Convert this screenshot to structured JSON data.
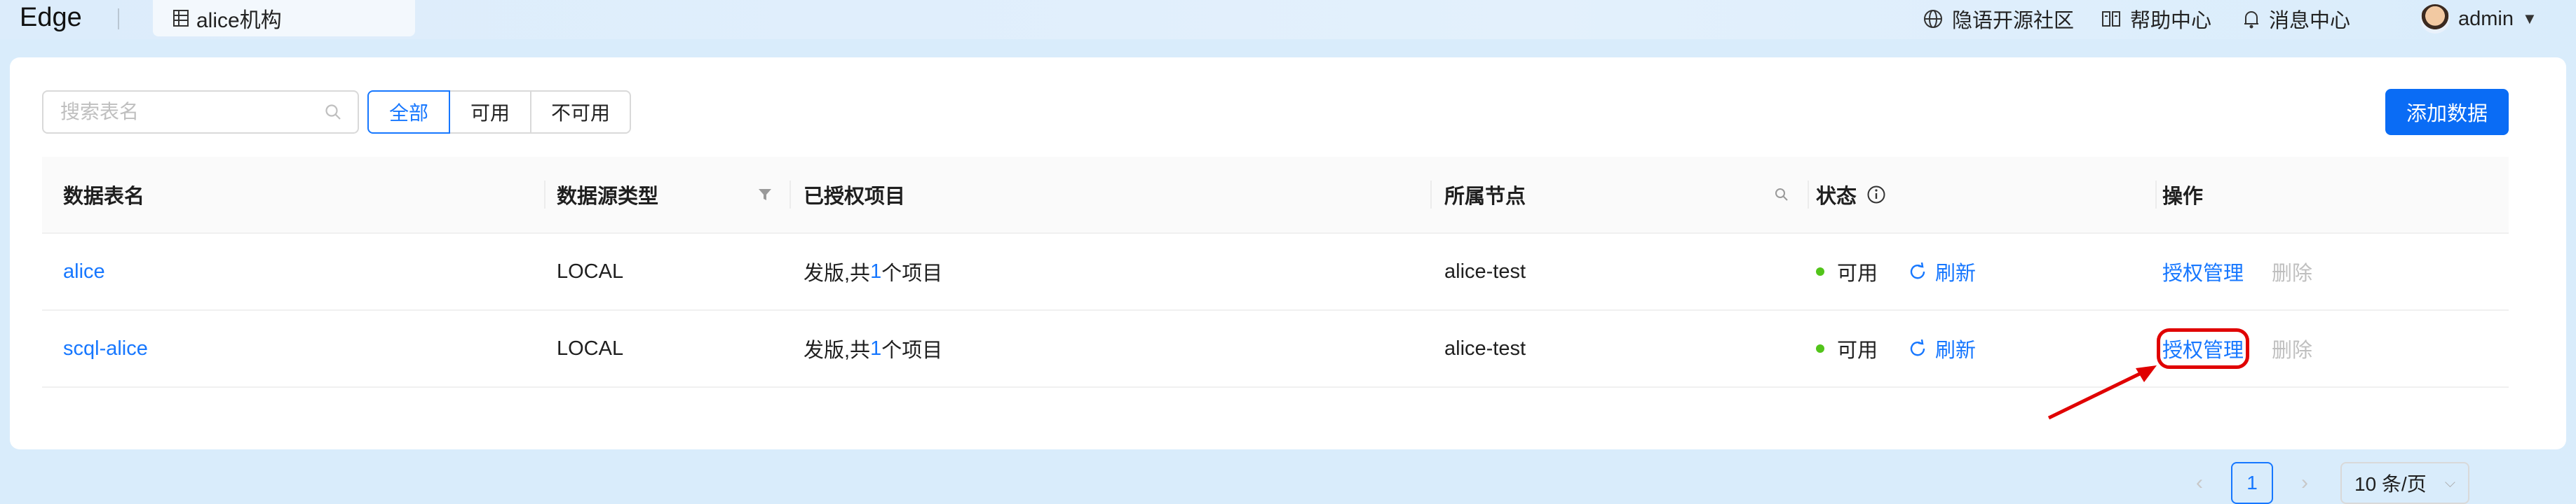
{
  "header": {
    "brand": "Edge",
    "org_tab": "alice机构",
    "nav": [
      {
        "label": "隐语开源社区",
        "icon": "globe-icon"
      },
      {
        "label": "帮助中心",
        "icon": "book-icon"
      },
      {
        "label": "消息中心",
        "icon": "bell-icon"
      }
    ],
    "user": "admin"
  },
  "toolbar": {
    "search_placeholder": "搜索表名",
    "filters": [
      "全部",
      "可用",
      "不可用"
    ],
    "active_filter": "全部",
    "add_button": "添加数据"
  },
  "table": {
    "columns": [
      "数据表名",
      "数据源类型",
      "已授权项目",
      "所属节点",
      "状态",
      "操作"
    ],
    "rows": [
      {
        "name": "alice",
        "source_type": "LOCAL",
        "auth_prefix": "发版,共",
        "auth_count": "1",
        "auth_suffix": "个项目",
        "node": "alice-test",
        "status": "可用",
        "refresh": "刷新",
        "action_manage": "授权管理",
        "action_delete": "删除"
      },
      {
        "name": "scql-alice",
        "source_type": "LOCAL",
        "auth_prefix": "发版,共",
        "auth_count": "1",
        "auth_suffix": "个项目",
        "node": "alice-test",
        "status": "可用",
        "refresh": "刷新",
        "action_manage": "授权管理",
        "action_delete": "删除"
      }
    ]
  },
  "pagination": {
    "current_page": "1",
    "page_size": "10 条/页"
  },
  "colors": {
    "primary": "#1677ff",
    "status_ok": "#52c41a",
    "annotation": "#e00000"
  }
}
